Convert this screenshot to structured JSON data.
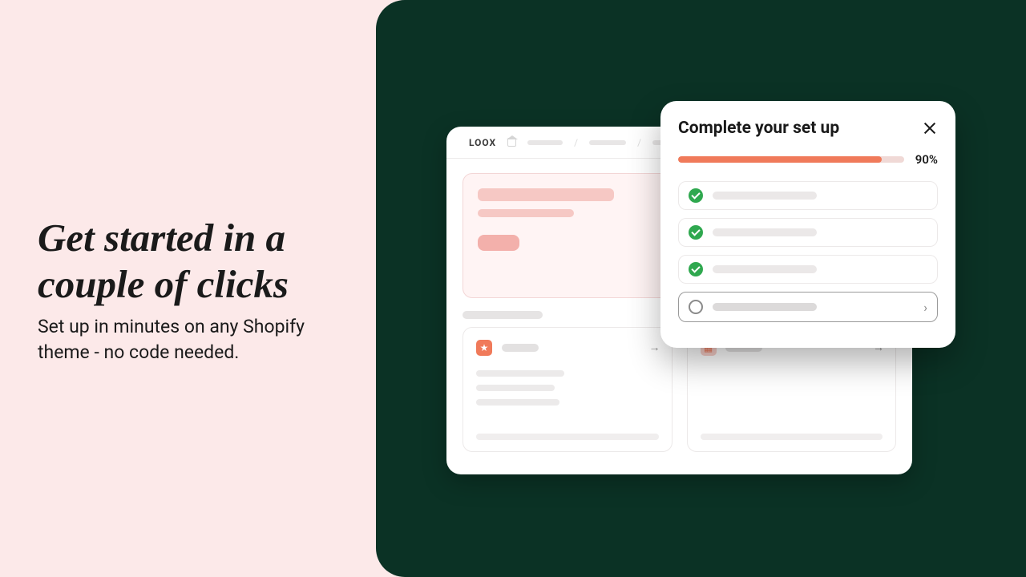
{
  "marketing": {
    "headline": "Get started in a couple of clicks",
    "subhead": "Set up in minutes on any Shopify theme - no code needed."
  },
  "browser": {
    "brand": "LOOX"
  },
  "setup_popover": {
    "title": "Complete your set up",
    "progress_percent_label": "90%",
    "progress_value": 90,
    "tasks": [
      {
        "status": "done"
      },
      {
        "status": "done"
      },
      {
        "status": "done"
      },
      {
        "status": "pending"
      }
    ]
  }
}
